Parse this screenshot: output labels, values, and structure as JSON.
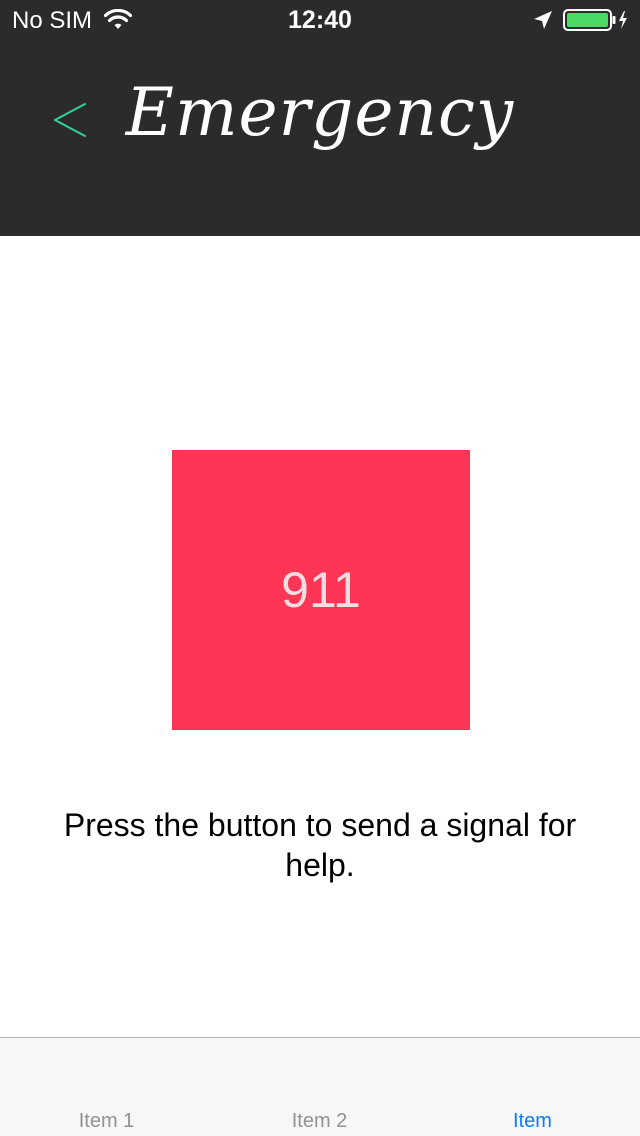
{
  "status_bar": {
    "carrier": "No SIM",
    "time": "12:40",
    "icons": [
      "wifi-icon",
      "location-arrow-icon",
      "battery-icon",
      "charging-bolt-icon"
    ]
  },
  "nav_bar": {
    "title": "Emergency",
    "back_icon": "chevron-left-icon"
  },
  "main": {
    "emergency_button_label": "911",
    "instruction": "Press the button to send a signal for help."
  },
  "tab_bar": {
    "tabs": [
      {
        "label": "Item 1",
        "selected": false
      },
      {
        "label": "Item 2",
        "selected": false
      },
      {
        "label": "Item",
        "selected": true
      }
    ]
  },
  "colors": {
    "header_background": "#2b2b2b",
    "back_chevron": "#2fd39a",
    "emergency_button": "#ff3555",
    "battery_fill": "#4cd964",
    "tab_selected": "#0a7aff",
    "tab_unselected": "#929292"
  }
}
